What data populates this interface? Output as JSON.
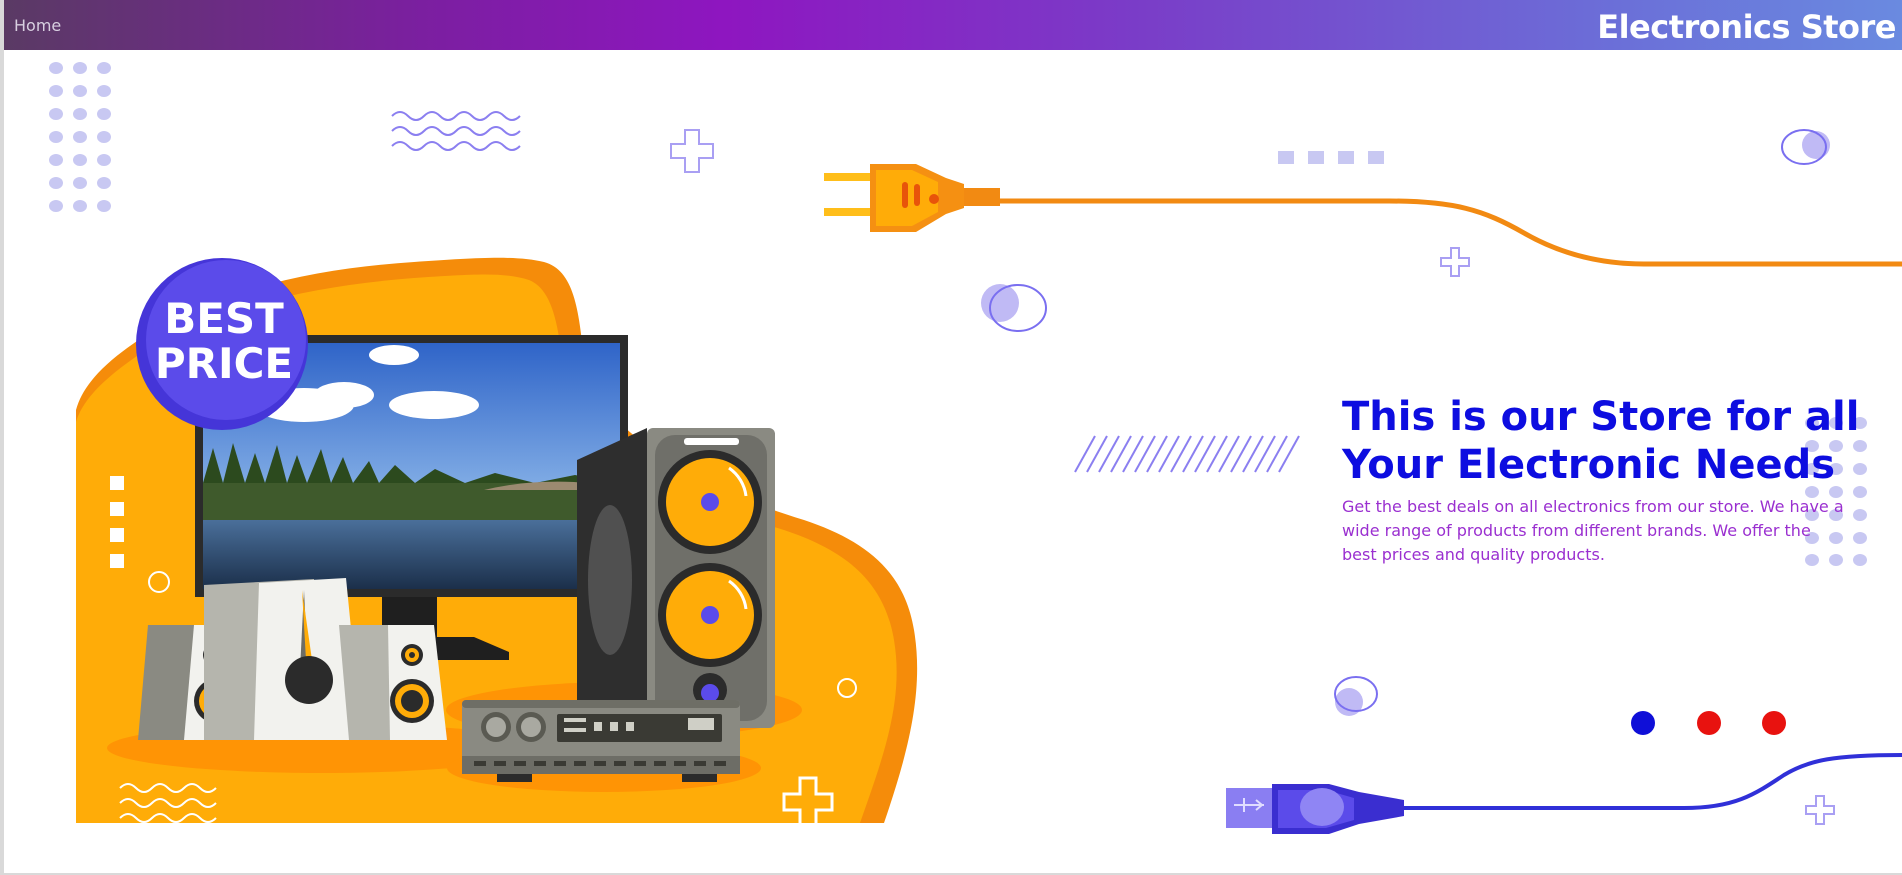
{
  "nav": {
    "home_label": "Home",
    "brand_title": "Electronics Store"
  },
  "banner": {
    "badge_line1": "BEST",
    "badge_line2": "PRICE",
    "headline_line1": "This is our Store for all",
    "headline_line2": "Your Electronic Needs",
    "description": "Get the best deals on all electronics from our store. We have a wide range of products from different brands. We offer the best prices and quality products."
  },
  "slider": {
    "active_slide": 1,
    "total_slides": 3,
    "active_color": "#0f0fd8",
    "inactive_color": "#e8120f"
  },
  "colors": {
    "nav_gradient_start": "#5a3a64",
    "nav_gradient_mid": "#8e16c0",
    "nav_gradient_end": "#6a8ae0",
    "headline": "#0d0de0",
    "description": "#9a2fd0",
    "orange": "#ffac08",
    "violet": "#5b4bea"
  },
  "icons": [
    "power-plug-icon",
    "usb-plug-icon",
    "plus-icon",
    "wave-icon",
    "dot-grid-icon"
  ]
}
